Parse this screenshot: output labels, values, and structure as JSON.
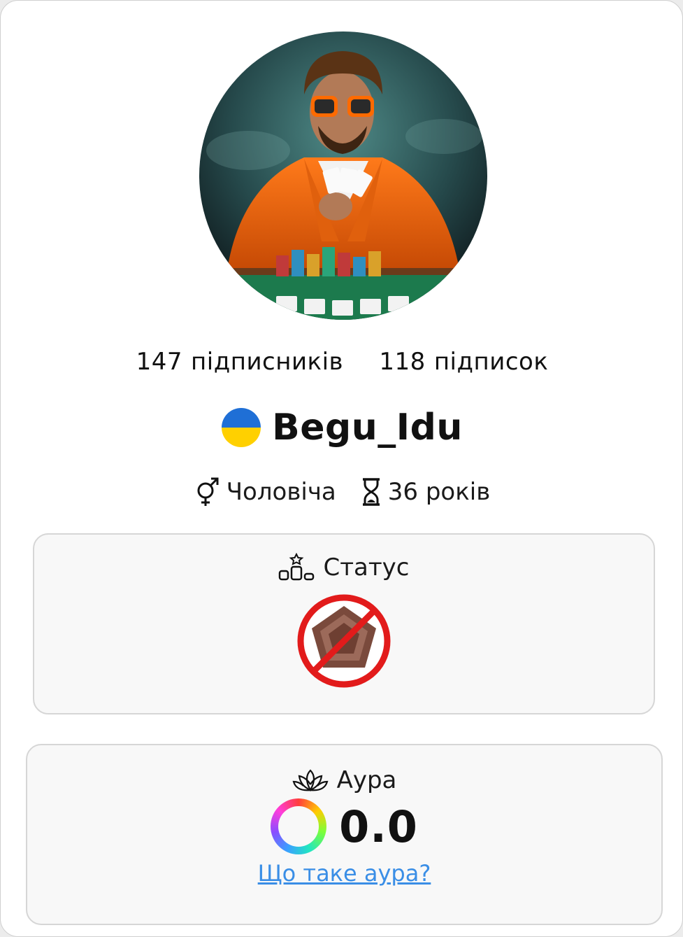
{
  "profile": {
    "avatar_icon": "profile-avatar-poker-player",
    "followers": {
      "count": "147",
      "label": "підписників"
    },
    "following": {
      "count": "118",
      "label": "підписок"
    },
    "flag_icon": "ukraine-flag-icon",
    "username": "Begu_Idu",
    "gender": {
      "icon": "gender-icon",
      "label": "Чоловіча"
    },
    "age": {
      "icon": "hourglass-icon",
      "label": "36 років"
    }
  },
  "status_card": {
    "icon": "podium-icon",
    "title": "Статус",
    "badge_icon": "no-status-badge-icon"
  },
  "aura_card": {
    "icon": "lotus-icon",
    "title": "Аура",
    "value": "0.0",
    "help_link": "Що таке аура?"
  },
  "colors": {
    "link": "#3a8ee6",
    "flag_blue": "#1f6fd6",
    "flag_yellow": "#ffd000",
    "prohibited_red": "#e21b1b"
  }
}
